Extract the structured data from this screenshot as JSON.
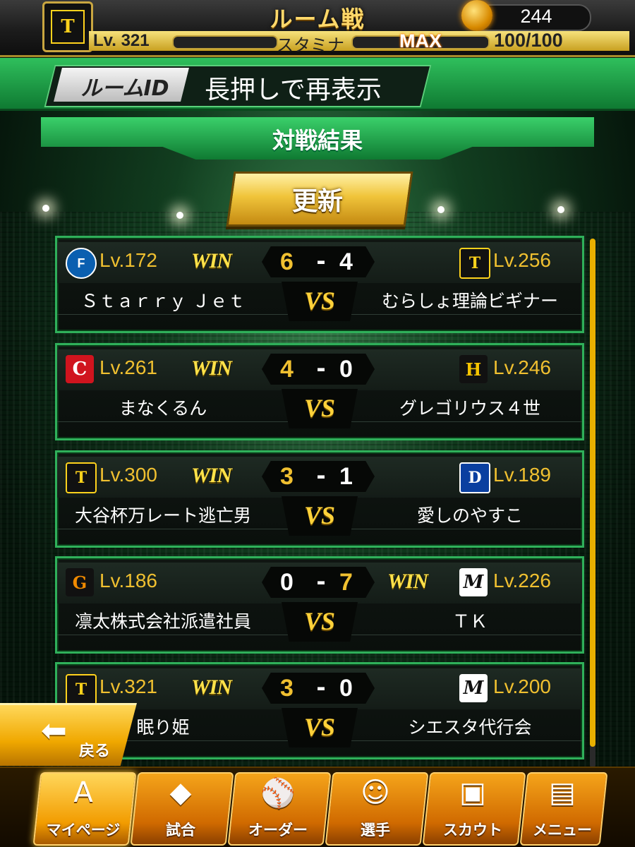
{
  "header": {
    "title": "ルーム戦",
    "level": "Lv. 321",
    "stamina_label": "スタミナ",
    "stamina_max": "MAX",
    "stamina_value": "100/100",
    "coins": "244"
  },
  "room": {
    "id_label": "ルームID",
    "id_value": "長押しで再表示"
  },
  "results": {
    "title": "対戦結果",
    "refresh_label": "更新"
  },
  "matches": [
    {
      "left_mark": "F",
      "left_level": "Lv.172",
      "left_name": "Ｓｔａｒｒｙ Ｊｅｔ",
      "left_score": "6",
      "right_score": "4",
      "right_mark": "T",
      "right_level": "Lv.256",
      "right_name": "むらしょ理論ビギナー",
      "winner": "left",
      "win_label": "WIN",
      "vs_label": "VS",
      "dash": "-"
    },
    {
      "left_mark": "C",
      "left_level": "Lv.261",
      "left_name": "まなくるん",
      "left_score": "4",
      "right_score": "0",
      "right_mark": "H",
      "right_level": "Lv.246",
      "right_name": "グレゴリウス４世",
      "winner": "left",
      "win_label": "WIN",
      "vs_label": "VS",
      "dash": "-"
    },
    {
      "left_mark": "T",
      "left_level": "Lv.300",
      "left_name": "大谷杯万レート逃亡男",
      "left_score": "3",
      "right_score": "1",
      "right_mark": "D",
      "right_level": "Lv.189",
      "right_name": "愛しのやすこ",
      "winner": "left",
      "win_label": "WIN",
      "vs_label": "VS",
      "dash": "-"
    },
    {
      "left_mark": "G",
      "left_level": "Lv.186",
      "left_name": "凛太株式会社派遣社員",
      "left_score": "0",
      "right_score": "7",
      "right_mark": "M",
      "right_level": "Lv.226",
      "right_name": "ＴＫ",
      "winner": "right",
      "win_label": "WIN",
      "vs_label": "VS",
      "dash": "-"
    },
    {
      "left_mark": "T",
      "left_level": "Lv.321",
      "left_name": "眠り姫",
      "left_score": "3",
      "right_score": "0",
      "right_mark": "M",
      "right_level": "Lv.200",
      "right_name": "シエスタ代行会",
      "winner": "left",
      "win_label": "WIN",
      "vs_label": "VS",
      "dash": "-"
    }
  ],
  "back": {
    "label": "戻る",
    "icon": "back-arrow-icon"
  },
  "nav": [
    {
      "label": "マイページ",
      "icon": "A"
    },
    {
      "label": "試合",
      "icon": "◆"
    },
    {
      "label": "オーダー",
      "icon": "⚾"
    },
    {
      "label": "選手",
      "icon": "☺"
    },
    {
      "label": "スカウト",
      "icon": "▣"
    },
    {
      "label": "メニュー",
      "icon": "▤"
    }
  ],
  "colors": {
    "accent_green": "#2fb05a",
    "gold": "#f0c030",
    "win_yellow": "#ffe24a",
    "nav_orange": "#f29c00"
  }
}
